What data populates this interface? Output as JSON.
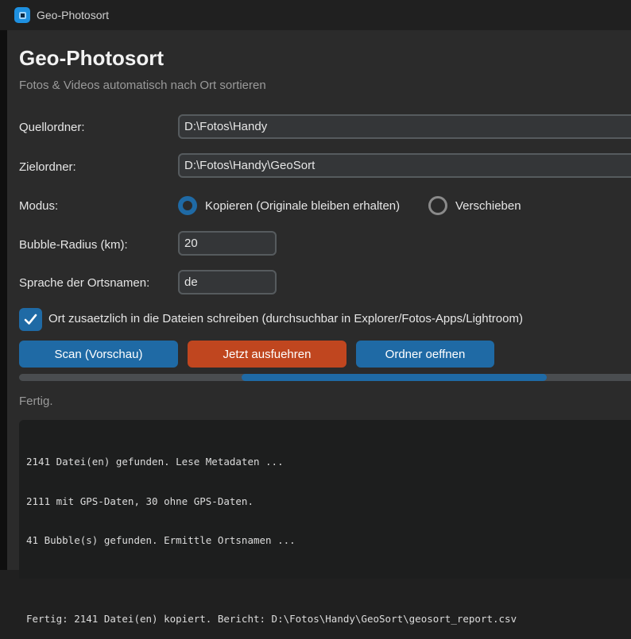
{
  "window": {
    "title": "Geo-Photosort",
    "icon": "app-icon"
  },
  "header": {
    "title": "Geo-Photosort",
    "subtitle": "Fotos & Videos automatisch nach Ort sortieren"
  },
  "form": {
    "source": {
      "label": "Quellordner:",
      "value": "D:\\Fotos\\Handy"
    },
    "target": {
      "label": "Zielordner:",
      "value": "D:\\Fotos\\Handy\\GeoSort"
    },
    "mode": {
      "label": "Modus:",
      "options": [
        {
          "label": "Kopieren (Originale bleiben erhalten)",
          "selected": true
        },
        {
          "label": "Verschieben",
          "selected": false
        }
      ]
    },
    "radius": {
      "label": "Bubble-Radius (km):",
      "value": "20"
    },
    "language": {
      "label": "Sprache der Ortsnamen:",
      "value": "de"
    },
    "write_location": {
      "label": "Ort zusaetzlich in die Dateien schreiben (durchsuchbar in Explorer/Fotos-Apps/Lightroom)",
      "checked": true
    }
  },
  "actions": {
    "scan_label": "Scan (Vorschau)",
    "run_label": "Jetzt ausfuehren",
    "open_label": "Ordner oeffnen"
  },
  "progress": {
    "indeterminate": true
  },
  "status": "Fertig.",
  "log": {
    "lines": [
      "2141 Datei(en) gefunden. Lese Metadaten ...",
      "2111 mit GPS-Daten, 30 ohne GPS-Daten.",
      "41 Bubble(s) gefunden. Ermittle Ortsnamen ...",
      "",
      "Fertig: 2141 Datei(en) kopiert. Bericht: D:\\Fotos\\Handy\\GeoSort\\geosort_report.csv"
    ]
  },
  "colors": {
    "accent": "#1f6aa5",
    "danger": "#c0461f",
    "background": "#2b2b2b"
  }
}
